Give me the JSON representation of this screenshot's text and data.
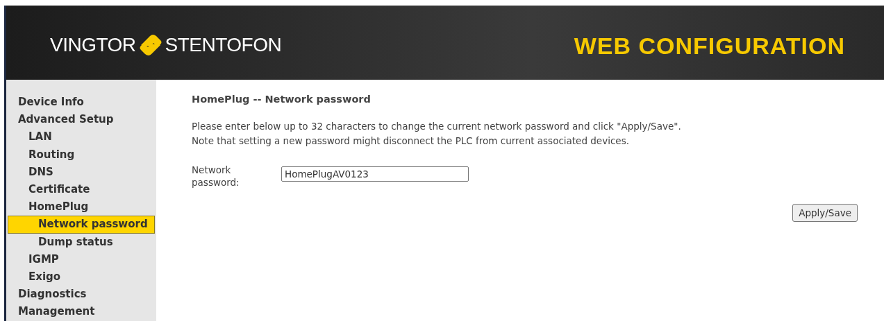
{
  "header": {
    "logo_left": "VINGTOR",
    "logo_right": "STENTOFON",
    "title": "WEB CONFIGURATION"
  },
  "sidebar": {
    "items": [
      {
        "label": "Device Info",
        "selected": false
      },
      {
        "label": "Advanced Setup",
        "selected": false,
        "children": [
          {
            "label": "LAN",
            "selected": false
          },
          {
            "label": "Routing",
            "selected": false
          },
          {
            "label": "DNS",
            "selected": false
          },
          {
            "label": "Certificate",
            "selected": false
          },
          {
            "label": "HomePlug",
            "selected": false,
            "children": [
              {
                "label": "Network password",
                "selected": true
              },
              {
                "label": "Dump status",
                "selected": false
              }
            ]
          },
          {
            "label": "IGMP",
            "selected": false
          },
          {
            "label": "Exigo",
            "selected": false
          }
        ]
      },
      {
        "label": "Diagnostics",
        "selected": false
      },
      {
        "label": "Management",
        "selected": false
      }
    ]
  },
  "content": {
    "heading": "HomePlug -- Network password",
    "description": [
      "Please enter below up to 32 characters to change the current network password and click \"Apply/Save\".",
      "Note that setting a new password might disconnect the PLC from current associated devices."
    ],
    "field": {
      "label": "Network password:",
      "value": "HomePlugAV0123"
    },
    "button": "Apply/Save"
  }
}
